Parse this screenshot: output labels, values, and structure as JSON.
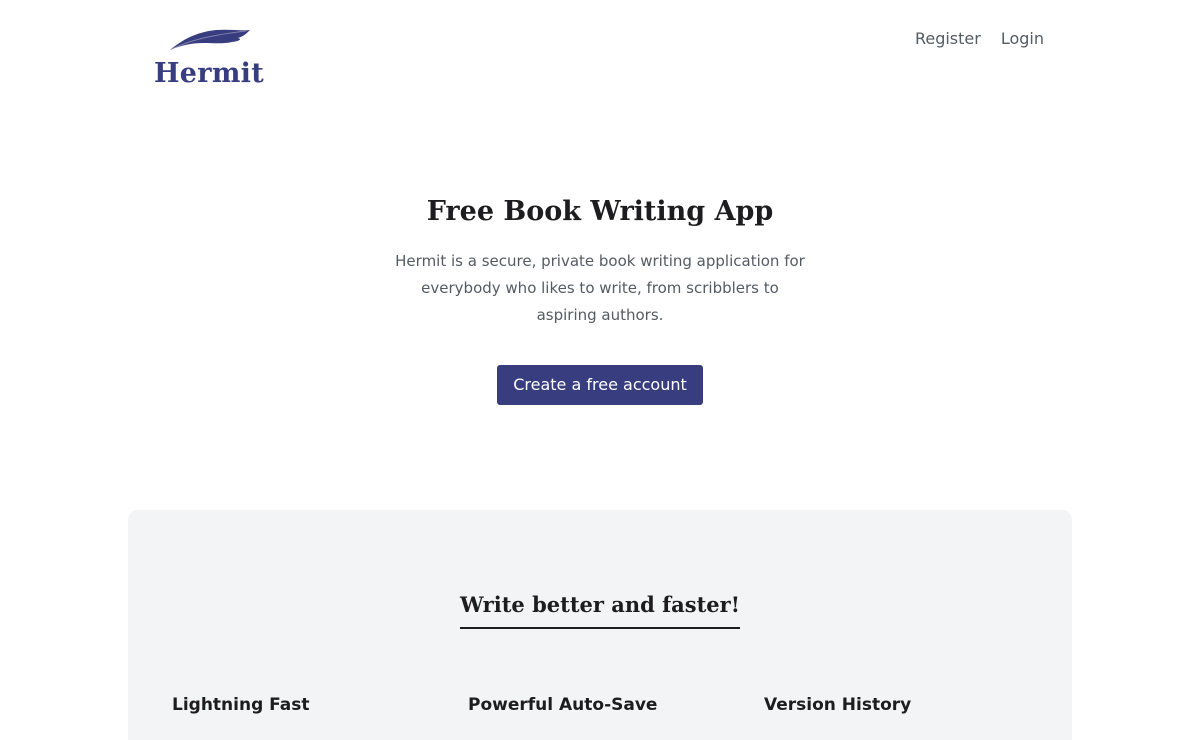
{
  "brand": {
    "name": "Hermit",
    "color": "#383d80",
    "logo_icon": "feather-icon"
  },
  "nav": {
    "register": "Register",
    "login": "Login"
  },
  "hero": {
    "title": "Free Book Writing App",
    "description": "Hermit is a secure, private book writing application for everybody who likes to write, from scribblers to aspiring authors.",
    "cta_label": "Create a free account"
  },
  "features": {
    "title": "Write better and faster!",
    "items": [
      {
        "title": "Lightning Fast"
      },
      {
        "title": "Powerful Auto-Save"
      },
      {
        "title": "Version History"
      }
    ]
  }
}
